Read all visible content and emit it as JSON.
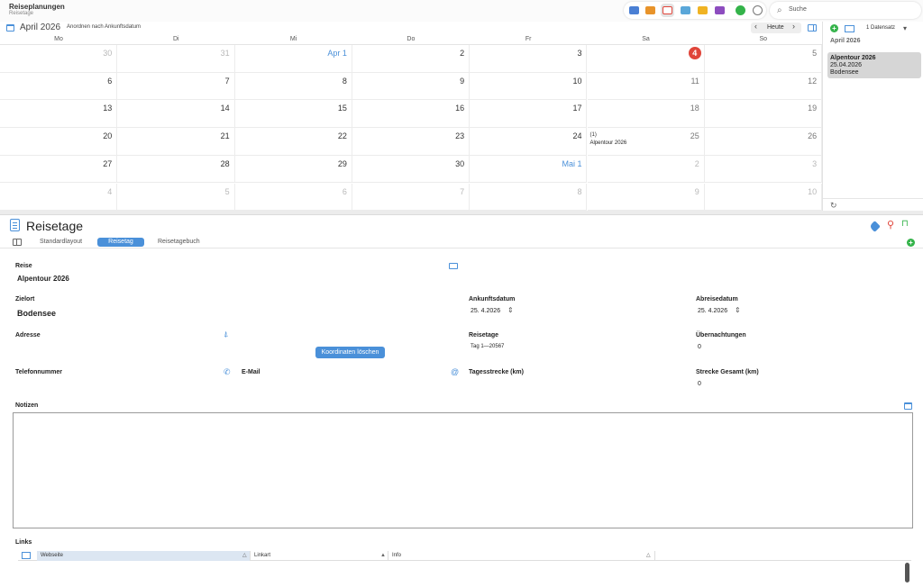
{
  "app": {
    "title": "Reiseplanungen",
    "subtitle": "Reisetage"
  },
  "toolbar": {
    "search_placeholder": "Suche"
  },
  "calendar": {
    "month_label": "April 2026",
    "sort_label": "Anordnen nach Ankunftsdatum",
    "today_label": "Heute",
    "prev": "‹",
    "next": "›",
    "weekdays": [
      "Mo",
      "Di",
      "Mi",
      "Do",
      "Fr",
      "Sa",
      "So"
    ],
    "weeks": [
      [
        "30",
        "31",
        "Apr 1",
        "2",
        "3",
        "4",
        "5"
      ],
      [
        "6",
        "7",
        "8",
        "9",
        "10",
        "11",
        "12"
      ],
      [
        "13",
        "14",
        "15",
        "16",
        "17",
        "18",
        "19"
      ],
      [
        "20",
        "21",
        "22",
        "23",
        "24",
        "25",
        "26"
      ],
      [
        "27",
        "28",
        "29",
        "30",
        "Mai 1",
        "2",
        "3"
      ],
      [
        "4",
        "5",
        "6",
        "7",
        "8",
        "9",
        "10"
      ]
    ],
    "event": {
      "count": "(1)",
      "name": "Alpentour 2026"
    }
  },
  "sidebar": {
    "add": "+",
    "count_label": "1 Datensatz",
    "menu": "▾",
    "month": "April 2026",
    "record": {
      "title": "Alpentour 2026",
      "date": "25.04.2026",
      "place": "Bodensee"
    },
    "refresh": "↻"
  },
  "detail": {
    "title": "Reisetage",
    "tabs": [
      "Standardlayout",
      "Reisetag",
      "Reisetagebuch"
    ],
    "add_layout": "+",
    "fields": {
      "reise_label": "Reise",
      "reise_value": "Alpentour 2026",
      "zielort_label": "Zielort",
      "zielort_value": "Bodensee",
      "ankunft_label": "Ankunftsdatum",
      "ankunft_value": "25.  4.2026",
      "abreise_label": "Abreisedatum",
      "abreise_value": "25.  4.2026",
      "adresse_label": "Adresse",
      "reisetage_label": "Reisetage",
      "reisetage_value": "Tag 1—20567",
      "uebernachtungen_label": "Übernachtungen",
      "uebernachtungen_value": "0",
      "telefon_label": "Telefonnummer",
      "email_label": "E-Mail",
      "tagesstrecke_label": "Tagesstrecke (km)",
      "strecke_gesamt_label": "Strecke Gesamt (km)",
      "strecke_gesamt_value": "0",
      "notizen_label": "Notizen",
      "links_label": "Links"
    },
    "coords_button": "Koordinaten löschen",
    "stepper": "⇕",
    "phone_icon": "✆",
    "email_icon": "@",
    "location_icon": "⍋",
    "links_columns": [
      "Webseite",
      "Linkart",
      "Info"
    ],
    "sort_icons": [
      "△",
      "▲",
      "△"
    ]
  },
  "colors": {
    "accent": "#4a90d9",
    "today": "#e0453a",
    "add": "#34b34a"
  }
}
